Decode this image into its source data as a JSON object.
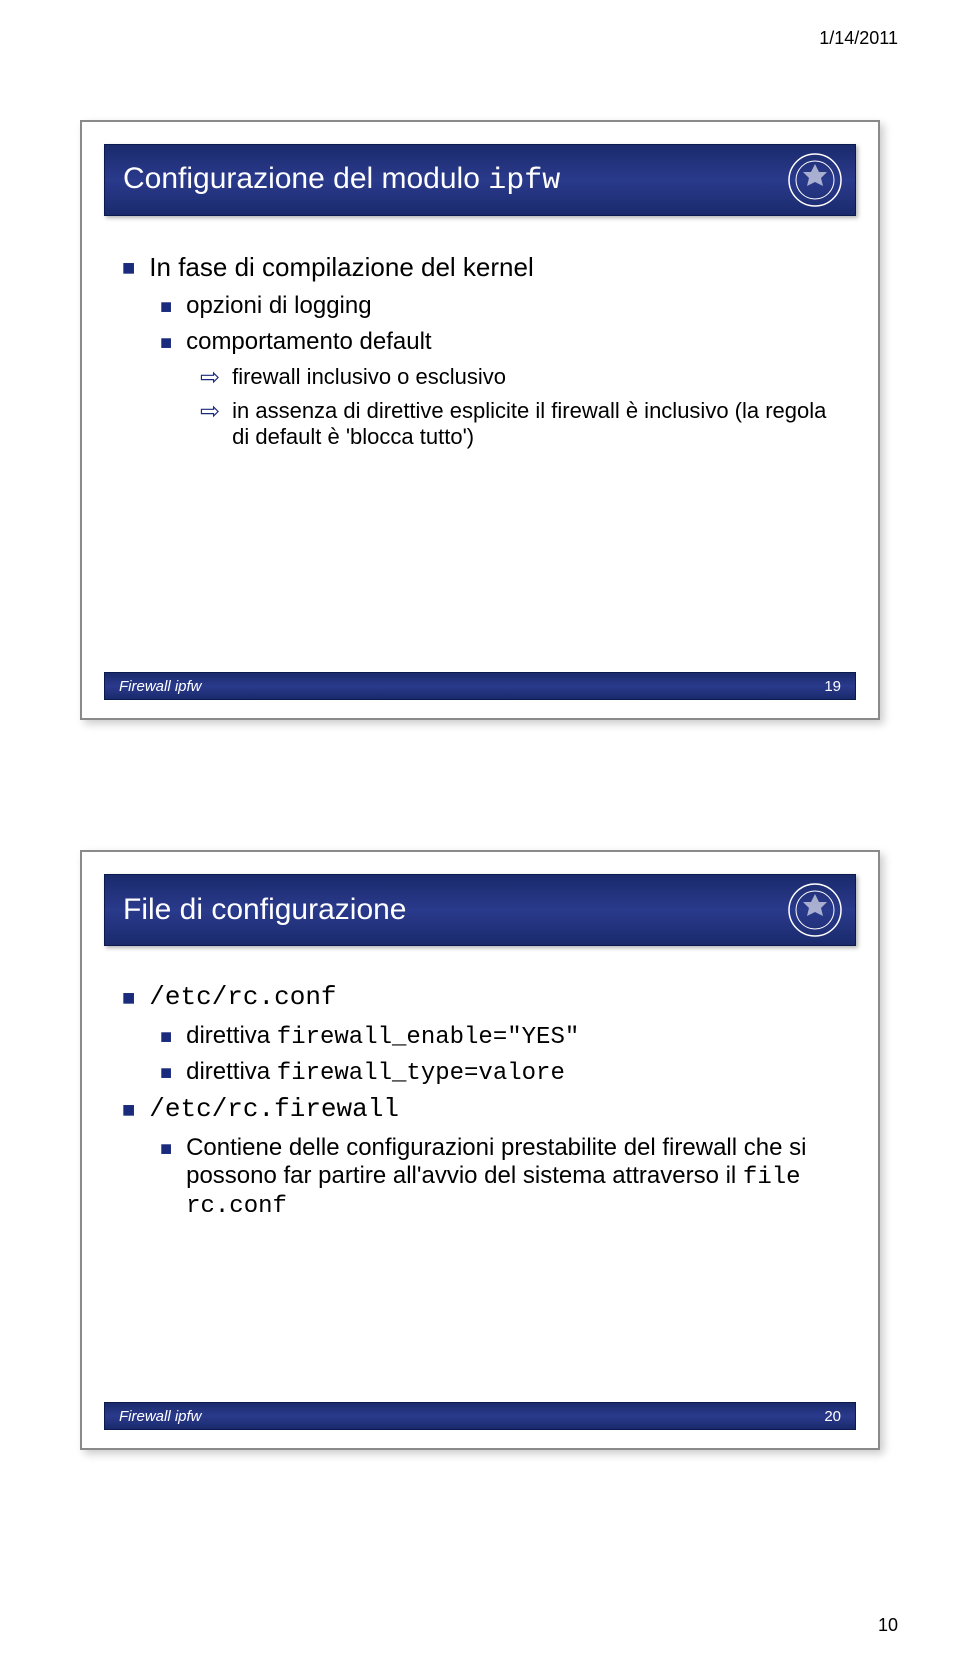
{
  "page_date": "1/14/2011",
  "page_number": "10",
  "slide1": {
    "title_plain": "Configurazione del modulo ",
    "title_mono": "ipfw",
    "footer_label": "Firewall ipfw",
    "footer_num": "19",
    "bullets": {
      "l1_0": "In fase di compilazione del kernel",
      "l2_0": "opzioni di logging",
      "l2_1": "comportamento default",
      "l3_0": "firewall inclusivo o esclusivo",
      "l3_1": "in assenza di direttive esplicite il firewall è inclusivo (la regola di default è 'blocca tutto')"
    }
  },
  "slide2": {
    "title": "File di configurazione",
    "footer_label": "Firewall ipfw",
    "footer_num": "20",
    "bullets": {
      "l1_0_mono": "/etc/rc.conf",
      "l2_0_a": "direttiva ",
      "l2_0_b_mono": "firewall_enable=\"YES\"",
      "l2_1_a": "direttiva ",
      "l2_1_b_mono": "firewall_type=valore",
      "l1_1_mono": "/etc/rc.firewall",
      "l2_2_a": "Contiene delle configurazioni prestabilite del firewall che si possono far partire all'avvio del sistema attraverso il ",
      "l2_2_b_mono": "file rc.conf"
    }
  }
}
